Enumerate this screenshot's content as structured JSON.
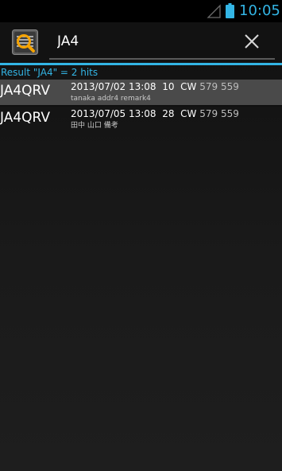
{
  "status_bar": {
    "time": "10:05",
    "colors": {
      "accent": "#33b5e5"
    },
    "icons": [
      "signal-icon",
      "battery-icon"
    ]
  },
  "action_bar": {
    "app_icon": "search-log-icon",
    "search": {
      "value": "JA4",
      "placeholder": ""
    },
    "close_icon": "close-icon"
  },
  "result": {
    "header": "Result \"JA4\" = 2 hits",
    "rows": [
      {
        "callsign": "JA4QRV",
        "datetime": "2013/07/02 13:08",
        "band": "10",
        "mode": "CW",
        "rst_sent": "579",
        "rst_rcvd": "559",
        "remark": "tanaka addr4 remark4",
        "selected": true
      },
      {
        "callsign": "JA4QRV",
        "datetime": "2013/07/05 13:08",
        "band": "28",
        "mode": "CW",
        "rst_sent": "579",
        "rst_rcvd": "559",
        "remark": "田中 山口 備考",
        "selected": false
      }
    ]
  }
}
